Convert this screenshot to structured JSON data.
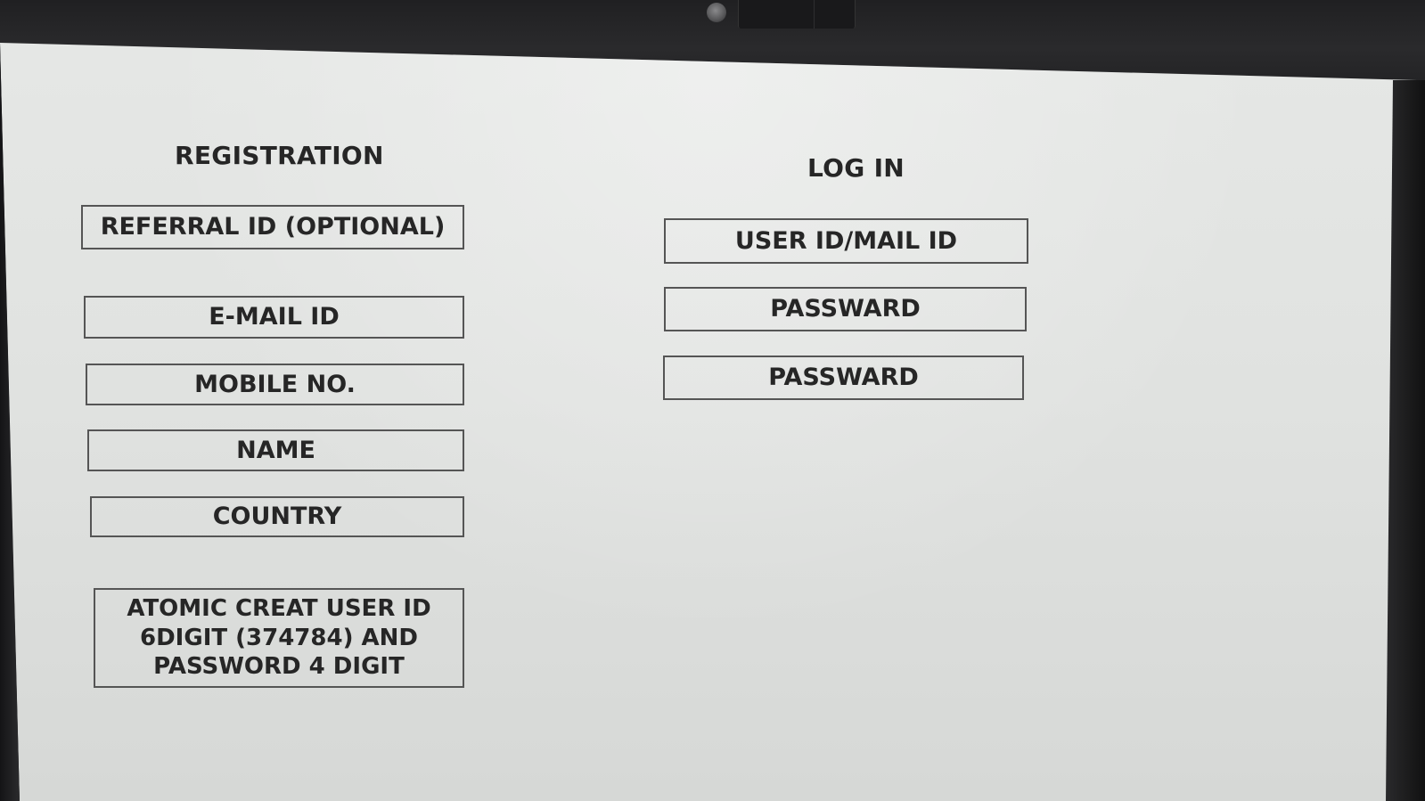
{
  "registration": {
    "title": "REGISTRATION",
    "fields": [
      {
        "label": "REFERRAL ID (OPTIONAL)"
      },
      {
        "label": "E-MAIL ID"
      },
      {
        "label": "MOBILE NO."
      },
      {
        "label": "NAME"
      },
      {
        "label": "COUNTRY"
      }
    ],
    "notice": "ATOMIC CREAT USER ID 6DIGIT (374784) AND PASSWORD 4 DIGIT",
    "notice_lines": [
      "ATOMIC CREAT USER ID",
      "6DIGIT (374784) AND",
      "PASSWORD 4 DIGIT"
    ]
  },
  "login": {
    "title": "LOG IN",
    "fields": [
      {
        "label": "USER ID/MAIL ID"
      },
      {
        "label": "PASSWARD"
      },
      {
        "label": "PASSWARD"
      }
    ]
  },
  "colors": {
    "screen_bg": "#e2e4e2",
    "text": "#262626",
    "border": "#555555",
    "bezel": "#202022"
  }
}
